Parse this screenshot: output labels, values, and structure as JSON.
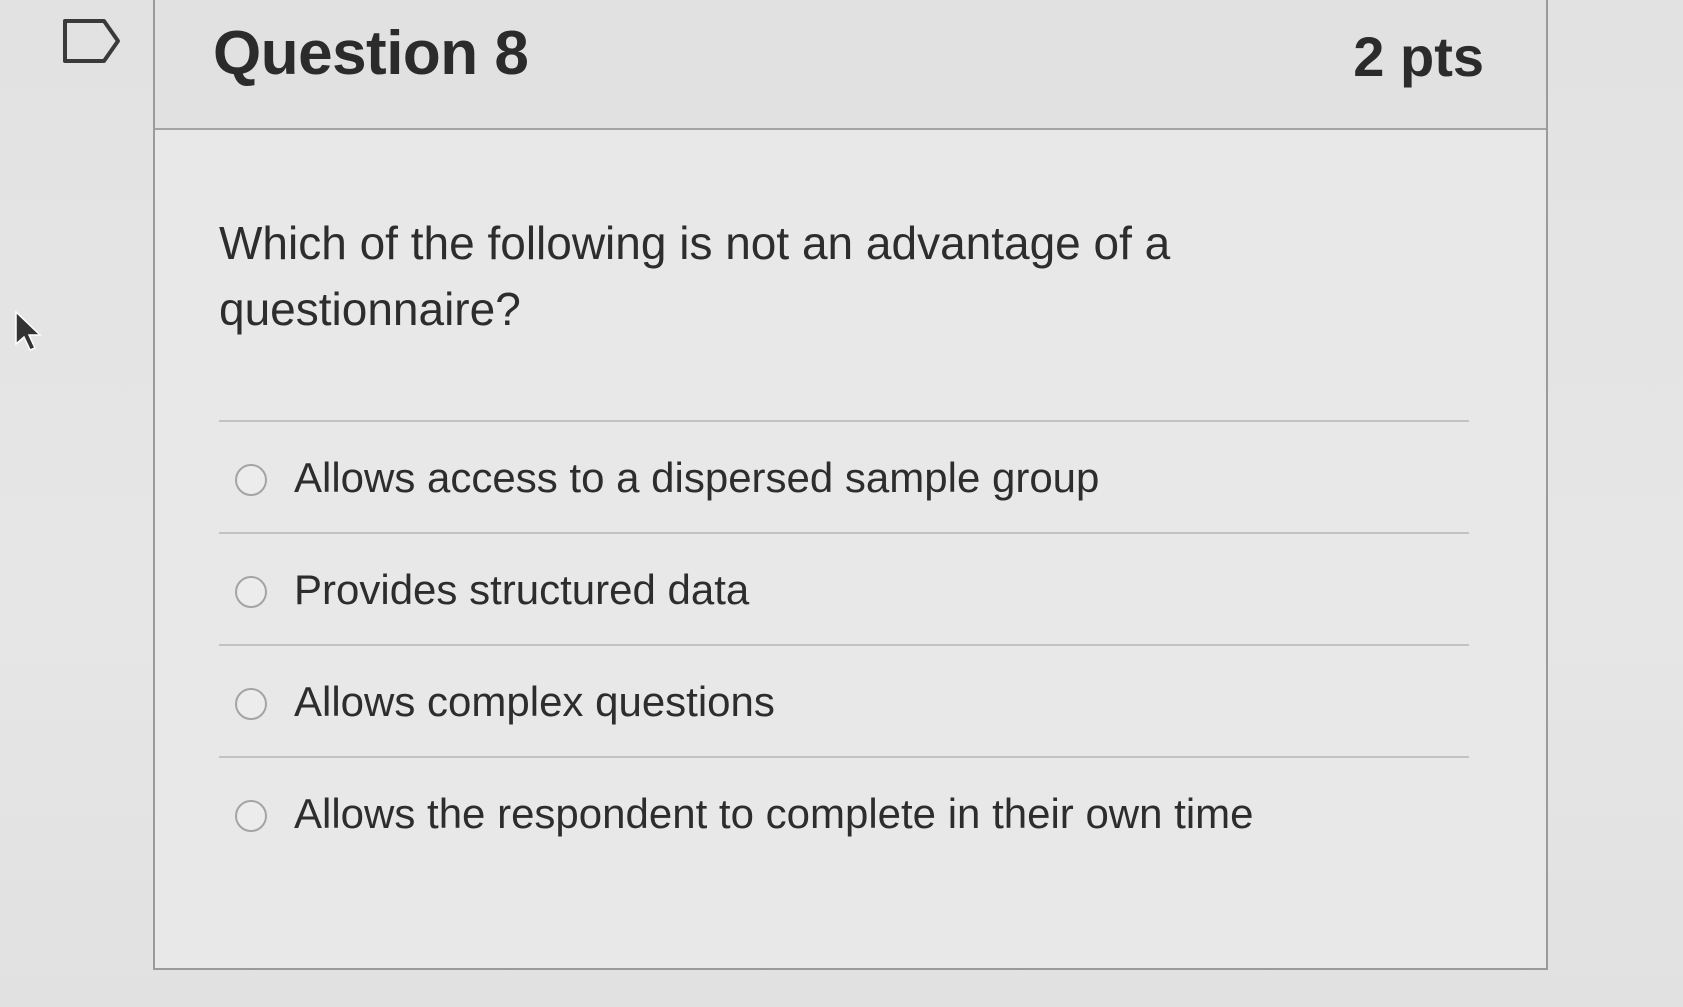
{
  "question": {
    "title": "Question 8",
    "points": "2 pts",
    "text": "Which of the following is not an advantage of a questionnaire?",
    "answers": [
      {
        "label": "Allows access to a dispersed sample group"
      },
      {
        "label": "Provides structured data"
      },
      {
        "label": "Allows complex questions"
      },
      {
        "label": "Allows the respondent to complete in their own time"
      }
    ]
  },
  "icons": {
    "flag": "flag-question-icon",
    "cursor": "mouse-pointer-icon",
    "radio": "radio-button-icon"
  },
  "colors": {
    "background": "#e4e4e4",
    "header_background": "#e1e1e1",
    "border": "#9a9a9a",
    "text": "#2d2d2d"
  }
}
